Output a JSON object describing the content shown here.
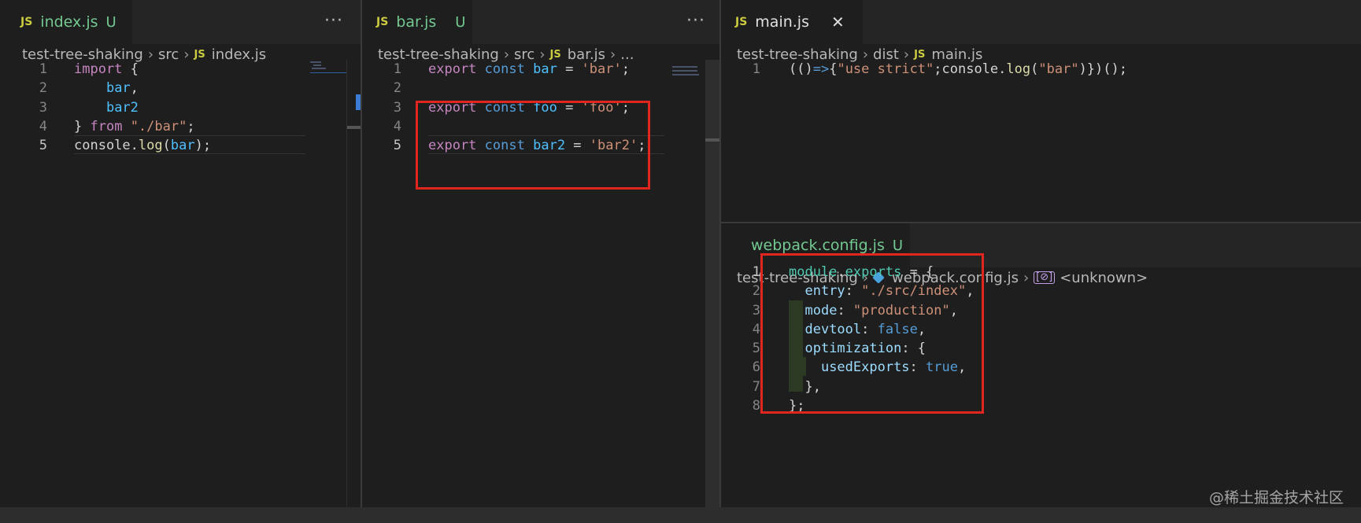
{
  "panes": {
    "left": {
      "tab": {
        "badge": "JS",
        "title": "index.js",
        "status": "U"
      },
      "more": "···",
      "breadcrumb": [
        "test-tree-shaking",
        "src",
        "index.js"
      ],
      "lines": [
        {
          "n": "1",
          "parts": [
            [
              "kw",
              "import"
            ],
            [
              "pl",
              " {"
            ]
          ]
        },
        {
          "n": "2",
          "parts": [
            [
              "pl",
              "    "
            ],
            [
              "var",
              "bar"
            ],
            [
              "pl",
              ","
            ]
          ]
        },
        {
          "n": "3",
          "parts": [
            [
              "pl",
              "    "
            ],
            [
              "var",
              "bar2"
            ]
          ]
        },
        {
          "n": "4",
          "parts": [
            [
              "pl",
              "} "
            ],
            [
              "kw",
              "from"
            ],
            [
              "pl",
              " "
            ],
            [
              "str",
              "\"./bar\""
            ],
            [
              "pl",
              ";"
            ]
          ]
        },
        {
          "n": "5",
          "parts": [
            [
              "pl",
              "console"
            ],
            [
              "pl",
              "."
            ],
            [
              "fn",
              "log"
            ],
            [
              "pl",
              "("
            ],
            [
              "var",
              "bar"
            ],
            [
              "pl",
              ");"
            ]
          ]
        }
      ]
    },
    "middle": {
      "tab": {
        "badge": "JS",
        "title": "bar.js",
        "status": "U"
      },
      "more": "···",
      "breadcrumb": [
        "test-tree-shaking",
        "src",
        "bar.js",
        "..."
      ],
      "lines": [
        {
          "n": "1",
          "parts": [
            [
              "kw",
              "export"
            ],
            [
              "pl",
              " "
            ],
            [
              "st",
              "const"
            ],
            [
              "pl",
              " "
            ],
            [
              "var",
              "bar"
            ],
            [
              "pl",
              " = "
            ],
            [
              "str",
              "'bar'"
            ],
            [
              "pl",
              ";"
            ]
          ]
        },
        {
          "n": "2",
          "parts": []
        },
        {
          "n": "3",
          "parts": [
            [
              "kw",
              "export"
            ],
            [
              "pl",
              " "
            ],
            [
              "st",
              "const"
            ],
            [
              "pl",
              " "
            ],
            [
              "var",
              "foo"
            ],
            [
              "pl",
              " = "
            ],
            [
              "str",
              "'foo'"
            ],
            [
              "pl",
              ";"
            ]
          ]
        },
        {
          "n": "4",
          "parts": []
        },
        {
          "n": "5",
          "parts": [
            [
              "kw",
              "export"
            ],
            [
              "pl",
              " "
            ],
            [
              "st",
              "const"
            ],
            [
              "pl",
              " "
            ],
            [
              "var",
              "bar2"
            ],
            [
              "pl",
              " = "
            ],
            [
              "str",
              "'bar2'"
            ],
            [
              "pl",
              ";"
            ]
          ]
        }
      ]
    },
    "right_top": {
      "tab": {
        "badge": "JS",
        "title": "main.js",
        "close": "✕"
      },
      "breadcrumb": [
        "test-tree-shaking",
        "dist",
        "main.js"
      ],
      "lines": [
        {
          "n": "1",
          "parts": [
            [
              "pl",
              "(()"
            ],
            [
              "st",
              "=>"
            ],
            [
              "pl",
              "{"
            ],
            [
              "str",
              "\"use strict\""
            ],
            [
              "pl",
              ";console."
            ],
            [
              "fn",
              "log"
            ],
            [
              "pl",
              "("
            ],
            [
              "str",
              "\"bar\""
            ],
            [
              "pl",
              ")})();"
            ]
          ]
        }
      ]
    },
    "right_bottom": {
      "tab": {
        "title": "webpack.config.js",
        "status": "U"
      },
      "breadcrumb": [
        "test-tree-shaking",
        "webpack.config.js",
        "<unknown>"
      ],
      "lines": [
        {
          "n": "1",
          "parts": [
            [
              "mod",
              "module"
            ],
            [
              "pl",
              "."
            ],
            [
              "mod",
              "exports"
            ],
            [
              "pl",
              " = {"
            ]
          ]
        },
        {
          "n": "2",
          "parts": [
            [
              "pl",
              "  "
            ],
            [
              "prop",
              "entry"
            ],
            [
              "pl",
              ": "
            ],
            [
              "str",
              "\"./src/index\""
            ],
            [
              "pl",
              ","
            ]
          ]
        },
        {
          "n": "3",
          "parts": [
            [
              "pl",
              "  "
            ],
            [
              "prop",
              "mode"
            ],
            [
              "pl",
              ": "
            ],
            [
              "str",
              "\"production\""
            ],
            [
              "pl",
              ","
            ]
          ]
        },
        {
          "n": "4",
          "parts": [
            [
              "pl",
              "  "
            ],
            [
              "prop",
              "devtool"
            ],
            [
              "pl",
              ": "
            ],
            [
              "st",
              "false"
            ],
            [
              "pl",
              ","
            ]
          ]
        },
        {
          "n": "5",
          "parts": [
            [
              "pl",
              "  "
            ],
            [
              "prop",
              "optimization"
            ],
            [
              "pl",
              ": {"
            ]
          ]
        },
        {
          "n": "6",
          "parts": [
            [
              "pl",
              "    "
            ],
            [
              "prop",
              "usedExports"
            ],
            [
              "pl",
              ": "
            ],
            [
              "st",
              "true"
            ],
            [
              "pl",
              ","
            ]
          ]
        },
        {
          "n": "7",
          "parts": [
            [
              "pl",
              "  },"
            ]
          ]
        },
        {
          "n": "8",
          "parts": [
            [
              "pl",
              "};"
            ]
          ]
        }
      ]
    }
  },
  "watermark": "@稀土掘金技术社区"
}
